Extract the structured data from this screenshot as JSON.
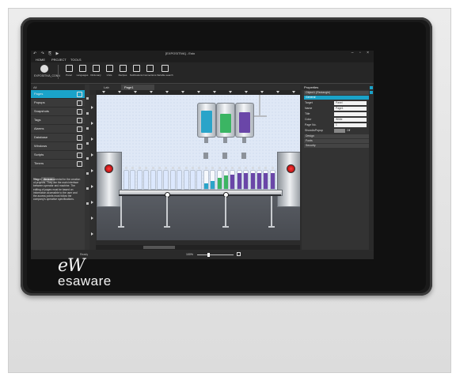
{
  "brand": {
    "mark": "eW",
    "name": "esaware"
  },
  "app": {
    "title": "[EXPOSITIVA] - Esto",
    "menus": [
      "HOME",
      "PROJECT",
      "TOOLS"
    ],
    "ribbon": {
      "big": {
        "label": "EXPOSITIVA_CONN"
      },
      "buttons": [
        {
          "label": "Panel",
          "icon": "panel-icon"
        },
        {
          "label": "Languages",
          "icon": "languages-icon"
        },
        {
          "label": "Dictionary",
          "icon": "dictionary-icon"
        },
        {
          "label": "Units",
          "icon": "units-icon"
        },
        {
          "label": "Recipes",
          "icon": "recipes-icon"
        },
        {
          "label": "Notifications",
          "icon": "notifications-icon"
        },
        {
          "label": "Connections",
          "icon": "connections-icon"
        },
        {
          "label": "Variable search",
          "icon": "variable-search-icon"
        }
      ]
    }
  },
  "left_panel": {
    "search": "All",
    "items": [
      {
        "label": "Pages",
        "active": true
      },
      {
        "label": "Popups",
        "active": false
      },
      {
        "label": "Snapshots",
        "active": false
      },
      {
        "label": "Tags",
        "active": false
      },
      {
        "label": "Alarms",
        "active": false
      },
      {
        "label": "Database",
        "active": false
      },
      {
        "label": "Windows",
        "active": false
      },
      {
        "label": "Scripts",
        "active": false
      },
      {
        "label": "Timers",
        "active": false
      }
    ],
    "tabs": [
      "Help",
      "Search"
    ],
    "description": "\"Pages\" are fundamental for the creation of projects. They are the main interface between operator and machine. The editing of pages must be based on information accessible to the user and the access points must follow the company's operative specifications."
  },
  "page_tabs": [
    {
      "label": "Lab",
      "active": false
    },
    {
      "label": "Page1",
      "active": true
    }
  ],
  "properties": {
    "title": "Properties",
    "selected": "Object1 (Rectangle)",
    "group": "General",
    "rows": [
      {
        "key": "Target",
        "value": "Panel"
      },
      {
        "key": "Name",
        "value": "Page1"
      },
      {
        "key": "Title",
        "value": ""
      },
      {
        "key": "Color",
        "value": "White"
      },
      {
        "key": "Page No.",
        "value": "1"
      }
    ],
    "toggle": {
      "key": "ShowAsPopup",
      "value": "Off"
    },
    "sections": [
      "Design",
      "Fonts",
      "Security"
    ]
  },
  "status": {
    "left": "Ready",
    "zoom": "100%",
    "zoom_fraction": 0.3
  },
  "canvas": {
    "tanks": [
      {
        "liquid": "#2aa4c9"
      },
      {
        "liquid": "#3bb563"
      },
      {
        "liquid": "#6a46a8"
      }
    ],
    "bottle_fills": [
      0,
      0,
      0,
      0,
      0,
      0,
      0,
      0,
      0,
      0,
      0,
      0,
      0.3,
      0.45,
      0.6,
      0.75,
      0.8,
      0.85,
      0.85,
      0.85,
      0.85,
      0.85,
      0.85
    ],
    "bottle_colors": [
      "#a9c8ff",
      "#a9c8ff",
      "#a9c8ff",
      "#a9c8ff",
      "#a9c8ff",
      "#a9c8ff",
      "#a9c8ff",
      "#a9c8ff",
      "#a9c8ff",
      "#a9c8ff",
      "#a9c8ff",
      "#a9c8ff",
      "#2aa4c9",
      "#2aa4c9",
      "#3bb563",
      "#3bb563",
      "#6a46a8",
      "#6a46a8",
      "#6a46a8",
      "#6a46a8",
      "#6a46a8",
      "#6a46a8",
      "#6a46a8"
    ]
  }
}
